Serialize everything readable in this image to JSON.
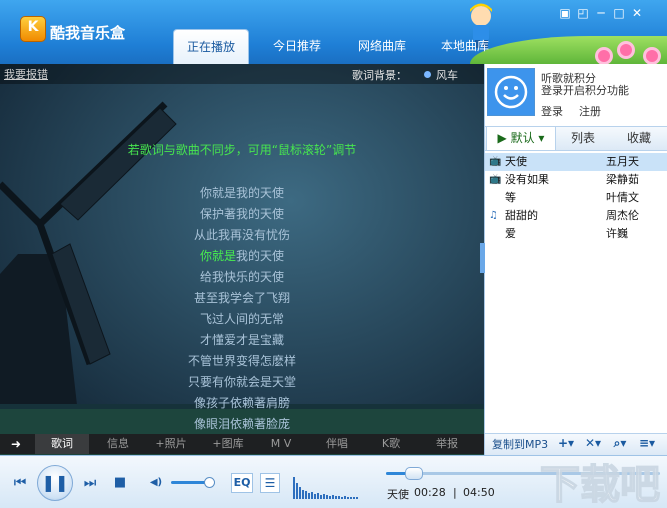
{
  "app": {
    "title": "酷我音乐盒",
    "logo_letter": "K"
  },
  "window_controls": {
    "skin": "▣",
    "mini": "◰",
    "minimize": "─",
    "maximize": "□",
    "close": "✕"
  },
  "main_tabs": [
    {
      "label": "正在播放",
      "active": true
    },
    {
      "label": "今日推荐",
      "active": false
    },
    {
      "label": "网络曲库",
      "active": false
    },
    {
      "label": "本地曲库",
      "active": false
    }
  ],
  "lyric_panel": {
    "report_link": "我要报错",
    "lyric_bg_label": "歌词背景：",
    "lyric_bg_value": "风车",
    "sync_hint": "若歌词与歌曲不同步，可用“鼠标滚轮”调节",
    "lines": [
      "你就是我的天使",
      "保护著我的天使",
      "从此我再没有忧伤",
      "你就是我的天使",
      "给我快乐的天使",
      "甚至我学会了飞翔",
      "飞过人间的无常",
      "才懂爱才是宝藏",
      "不管世界变得怎麽样",
      "只要有你就会是天堂",
      "像孩子依赖著肩膀",
      "像眼泪依赖著脸庞"
    ],
    "current_line_index": 3,
    "current_line_sung": "你就是",
    "current_line_rest": "我的天使"
  },
  "lyric_tabs": {
    "arrow": "➜",
    "items": [
      {
        "label": "歌词",
        "active": true
      },
      {
        "label": "信息",
        "active": false
      },
      {
        "label": "+照片",
        "active": false
      },
      {
        "label": "+图库",
        "active": false
      },
      {
        "label": "M V",
        "active": false
      },
      {
        "label": "伴唱",
        "active": false
      },
      {
        "label": "K歌",
        "active": false
      },
      {
        "label": "举报",
        "active": false
      }
    ]
  },
  "user": {
    "line1": "听歌就积分",
    "line2": "登录开启积分功能",
    "login": "登录",
    "register": "注册"
  },
  "playlist_tabs": [
    {
      "label": "▶ 默认 ▾",
      "active": true
    },
    {
      "label": "列表",
      "active": false
    },
    {
      "label": "收藏",
      "active": false
    }
  ],
  "songs": [
    {
      "title": "天使",
      "artist": "五月天",
      "icon": "tv",
      "selected": true
    },
    {
      "title": "没有如果",
      "artist": "梁静茹",
      "icon": "tv",
      "selected": false
    },
    {
      "title": "等",
      "artist": "叶倩文",
      "icon": "",
      "selected": false
    },
    {
      "title": "甜甜的",
      "artist": "周杰伦",
      "icon": "note",
      "selected": false
    },
    {
      "title": "爱",
      "artist": "许巍",
      "icon": "",
      "selected": false
    }
  ],
  "playlist_footer": {
    "copy_label": "复制到MP3",
    "add": "+▾",
    "remove": "✕▾",
    "search": "⌕▾",
    "menu": "≡▾"
  },
  "player": {
    "prev": "⏮",
    "pause": "❚❚",
    "next": "⏭",
    "stop": "■",
    "volume_icon": "◀)",
    "volume_level": 0.85,
    "eq_label": "EQ",
    "list_icon": "☰",
    "now_playing_title": "天使",
    "time_current": "00:28",
    "time_separator": "|",
    "time_total": "04:50",
    "progress": 0.1
  },
  "watermark": "下载吧",
  "colors": {
    "accent": "#1f7fd6",
    "lyric_highlight": "#48f04f",
    "lyric_normal": "#a9c3d8"
  }
}
